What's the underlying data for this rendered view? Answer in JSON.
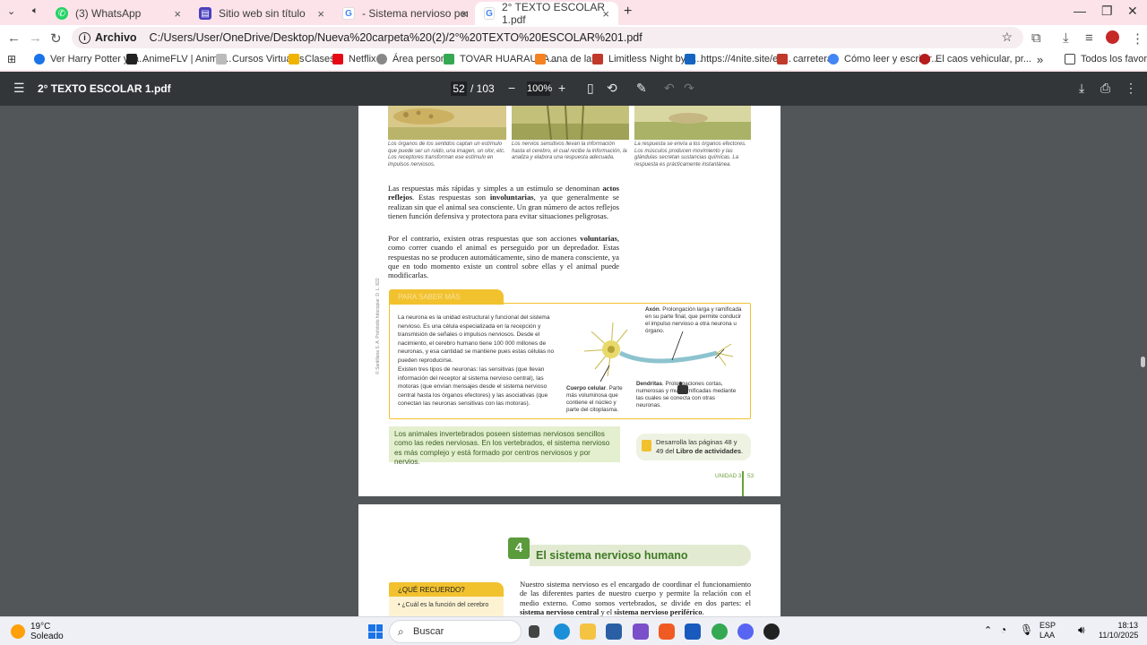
{
  "browser": {
    "tabs": [
      {
        "label": "(3) WhatsApp"
      },
      {
        "label": "Sitio web sin título"
      },
      {
        "label": "- Sistema nervioso periférico. -"
      },
      {
        "label": "2° TEXTO ESCOLAR 1.pdf",
        "active": true
      }
    ],
    "new_tab": "+",
    "address": {
      "chip": "Archivo",
      "url": "C:/Users/User/OneDrive/Desktop/Nueva%20carpeta%20(2)/2°%20TEXTO%20ESCOLAR%201.pdf"
    },
    "bookmarks": [
      {
        "label": "Ver Harry Potter y la...",
        "color": "#1a73e8"
      },
      {
        "label": "AnimeFLV | Anime...",
        "color": "#222222"
      },
      {
        "label": "Cursos Virtuales",
        "color": "#888888"
      },
      {
        "label": "Clases",
        "color": "#f0b400"
      },
      {
        "label": "Netflix",
        "color": "#e50914"
      },
      {
        "label": "Área personal",
        "color": "#666666"
      },
      {
        "label": "TOVAR HUARAUYA...",
        "color": "#34a853"
      },
      {
        "label": "ana de las",
        "color": "#f58220"
      },
      {
        "label": "Limitless Night by g...",
        "color": "#c0392b"
      },
      {
        "label": "https://4nite.site/es...",
        "color": "#1565c0"
      },
      {
        "label": "carretera",
        "color": "#c0392b"
      },
      {
        "label": "Cómo leer y escribir...",
        "color": "#4285f4"
      },
      {
        "label": "El caos vehicular, pr...",
        "color": "#b71c1c"
      }
    ],
    "bookmarks_more": "»",
    "all_bookmarks": "Todos los favoritos"
  },
  "pdf": {
    "title": "2° TEXTO ESCOLAR 1.pdf",
    "page_current": "52",
    "page_total": "/ 103",
    "zoom": "100%"
  },
  "page1": {
    "captions": [
      "Los órganos de los sentidos captan un estímulo que puede ser un ruido, una imagen, un olor, etc. Los receptores transforman ese estímulo en impulsos nerviosos.",
      "Los nervios sensitivos llevan la información hasta el cerebro, el cual recibe la información, la analiza y elabora una respuesta adecuada.",
      "La respuesta se envía a los órganos efectores. Los músculos producen movimiento y las glándulas secretan sustancias químicas. La respuesta es prácticamente instantánea."
    ],
    "para1_a": "Las respuestas más rápidas y simples a un estímulo se denominan ",
    "para1_b": "actos reflejos",
    "para1_c": ". Estas respuestas son ",
    "para1_d": "involuntarias",
    "para1_e": ", ya que generalmente se realizan sin que el animal sea consciente. Un gran número de actos reflejos tienen función defensiva y protectora para evitar situaciones peligrosas.",
    "para2_a": "Por el contrario, existen otras respuestas que son acciones ",
    "para2_b": "voluntarias",
    "para2_c": ", como correr cuando el animal es perseguido por un depredador. Estas respuestas no se producen automáticamente, sino de manera consciente, ya que en todo momento existe un control sobre ellas y el animal puede modificarlas.",
    "info_tab": "PARA SABER MÁS",
    "info_p1": "La neurona es la unidad estructural y funcional del sistema nervioso. Es una célula especializada en la recepción y transmisión de señales o impulsos nerviosos. Desde el nacimiento, el cerebro humano tiene 100 000 millones de neuronas, y esa cantidad se mantiene pues estas células no pueden reproducirse.",
    "info_p2": "Existen tres tipos de neuronas: las sensitivas (que llevan información del receptor al sistema nervioso central), las motoras (que envían mensajes desde el sistema nervioso central hasta los órganos efectores) y las asociativas (que conectan las neuronas sensitivas con las motoras).",
    "axon_label": "Axón",
    "axon_text": ". Prolongación larga y ramificada en su parte final, que permite conducir el impulso nervioso a otra neurona u órgano.",
    "cuerpo_label": "Cuerpo celular",
    "cuerpo_text": ". Parte más voluminosa que contiene el núcleo y parte del citoplasma.",
    "dendritas_label": "Dendritas",
    "dendritas_text": ". Prolongaciones cortas, numerosas y muy ramificadas mediante las cuales se conecta con otras neuronas.",
    "green_box": "Los animales invertebrados poseen sistemas nerviosos sencillos como las redes nerviosas. En los vertebrados, el sistema nervioso es más complejo y está formado por centros nerviosos y por nervios.",
    "activity_a": "Desarrolla las páginas 48 y 49 del ",
    "activity_b": "Libro de actividades",
    "activity_c": ".",
    "footer_unit": "UNIDAD 3",
    "footer_page": "53",
    "side_credit": "© Santillana S. A. Prohibido fotocopiar. D. L. 822"
  },
  "page2": {
    "section_number": "4",
    "section_title": "El sistema nervioso humano",
    "recuerdo_title": "¿QUÉ RECUERDO?",
    "recuerdo_item": "• ¿Cuál es la función del cerebro",
    "text_a": "Nuestro sistema nervioso es el encargado de coordinar el funcionamiento de las diferentes partes de nuestro cuerpo y permite la relación con el medio externo. Como somos vertebrados, se divide en dos partes: el ",
    "text_b": "sistema nervioso central",
    "text_c": " y el ",
    "text_d": "sistema nervioso periférico",
    "text_e": "."
  },
  "taskbar": {
    "temp": "19°C",
    "weather": "Soleado",
    "search": "Buscar",
    "lang1": "ESP",
    "lang2": "LAA",
    "time": "18:13",
    "date": "11/10/2025"
  }
}
